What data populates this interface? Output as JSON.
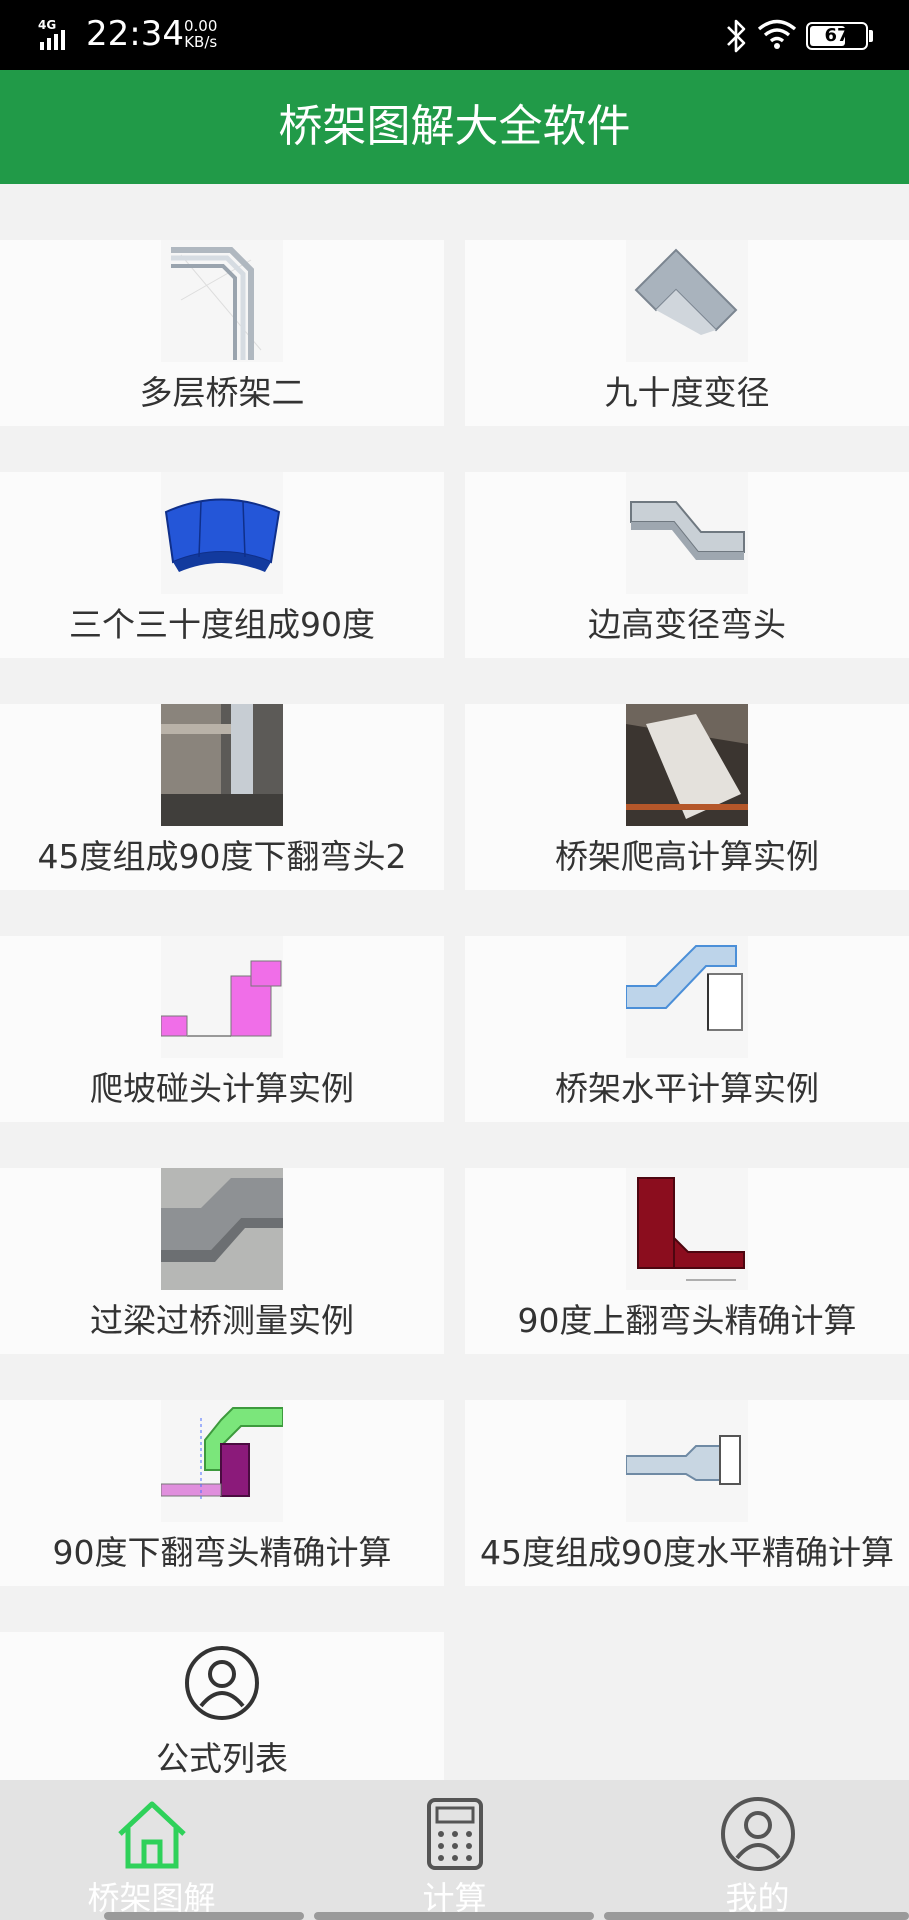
{
  "status_bar": {
    "network": "4G",
    "time": "22:34",
    "speed_value": "0.00",
    "speed_unit": "KB/s",
    "battery": "67",
    "battery_level": 0.67
  },
  "header": {
    "title": "桥架图解大全软件"
  },
  "items": [
    {
      "label": "多层桥架二",
      "icon": "multi-layer-tray-icon"
    },
    {
      "label": "九十度变径",
      "icon": "ninety-degree-reducer-icon"
    },
    {
      "label": "三个三十度组成90度",
      "icon": "three-thirty-degree-bend-icon"
    },
    {
      "label": "边高变径弯头",
      "icon": "side-height-reducer-elbow-icon"
    },
    {
      "label": "45度组成90度下翻弯头2",
      "icon": "photo-45-degree-down-bend-icon"
    },
    {
      "label": "桥架爬高计算实例",
      "icon": "photo-tray-climb-icon"
    },
    {
      "label": "爬坡碰头计算实例",
      "icon": "slope-joint-diagram-icon"
    },
    {
      "label": "桥架水平计算实例",
      "icon": "horizontal-tray-diagram-icon"
    },
    {
      "label": "过梁过桥测量实例",
      "icon": "photo-beam-crossing-icon"
    },
    {
      "label": "90度上翻弯头精确计算",
      "icon": "up-bend-diagram-icon"
    },
    {
      "label": "90度下翻弯头精确计算",
      "icon": "down-bend-diagram-icon"
    },
    {
      "label": "45度组成90度水平精确计算",
      "icon": "horizontal-45-diagram-icon"
    },
    {
      "label": "公式列表",
      "icon": "user-circle-icon"
    }
  ],
  "tabs": [
    {
      "label": "桥架图解",
      "icon": "home-icon",
      "active": true
    },
    {
      "label": "计算",
      "icon": "calculator-icon",
      "active": false
    },
    {
      "label": "我的",
      "icon": "user-icon",
      "active": false
    }
  ],
  "colors": {
    "primary": "#219a48",
    "active_tab": "#2fd15a",
    "tab_inactive": "#555555"
  }
}
